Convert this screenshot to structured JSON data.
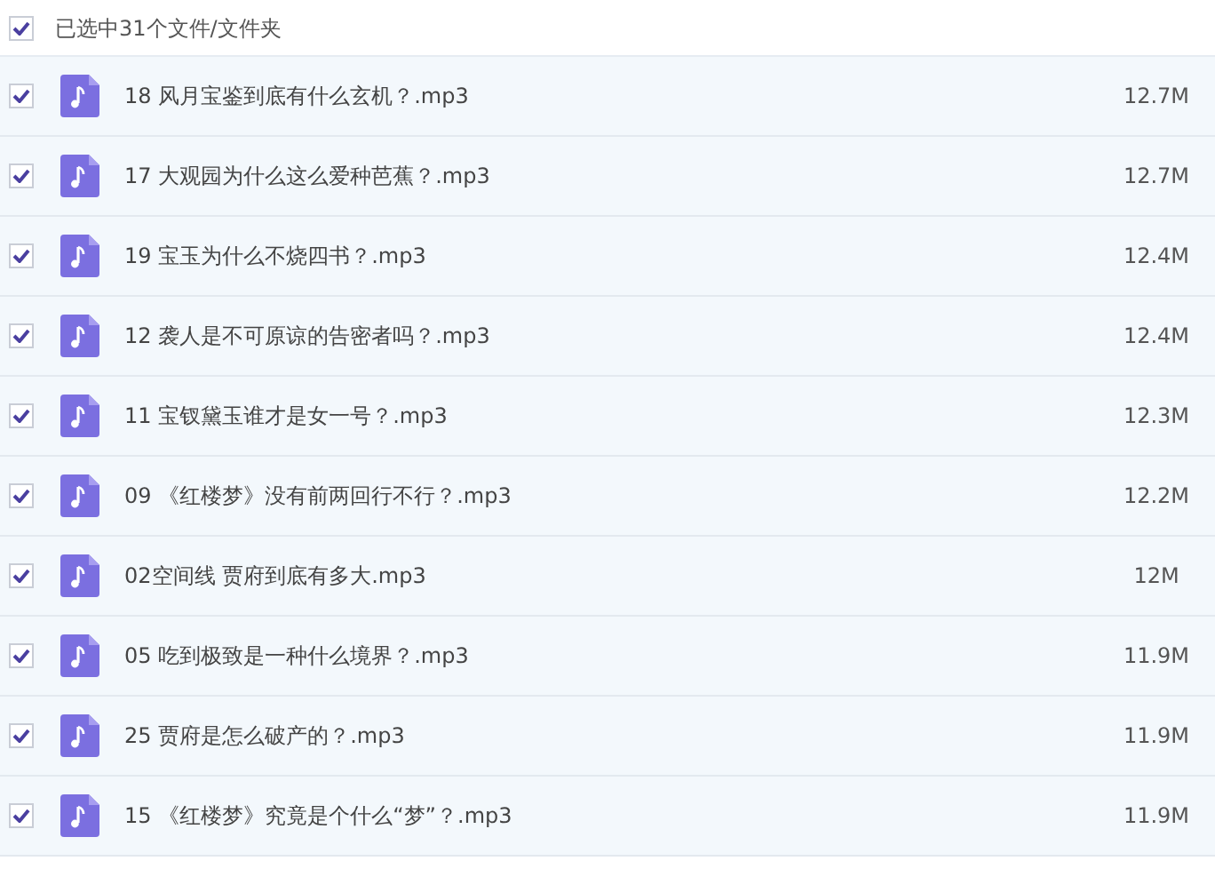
{
  "header": {
    "checked": true,
    "label": "已选中31个文件/文件夹"
  },
  "files": [
    {
      "checked": true,
      "name": "18 风月宝鉴到底有什么玄机？.mp3",
      "size": "12.7M"
    },
    {
      "checked": true,
      "name": "17 大观园为什么这么爱种芭蕉？.mp3",
      "size": "12.7M"
    },
    {
      "checked": true,
      "name": "19 宝玉为什么不烧四书？.mp3",
      "size": "12.4M"
    },
    {
      "checked": true,
      "name": "12 袭人是不可原谅的告密者吗？.mp3",
      "size": "12.4M"
    },
    {
      "checked": true,
      "name": "11 宝钗黛玉谁才是女一号？.mp3",
      "size": "12.3M"
    },
    {
      "checked": true,
      "name": "09 《红楼梦》没有前两回行不行？.mp3",
      "size": "12.2M"
    },
    {
      "checked": true,
      "name": "02空间线 贾府到底有多大.mp3",
      "size": "12M"
    },
    {
      "checked": true,
      "name": "05 吃到极致是一种什么境界？.mp3",
      "size": "11.9M"
    },
    {
      "checked": true,
      "name": "25 贾府是怎么破产的？.mp3",
      "size": "11.9M"
    },
    {
      "checked": true,
      "name": "15 《红楼梦》究竟是个什么“梦”？.mp3",
      "size": "11.9M"
    }
  ]
}
